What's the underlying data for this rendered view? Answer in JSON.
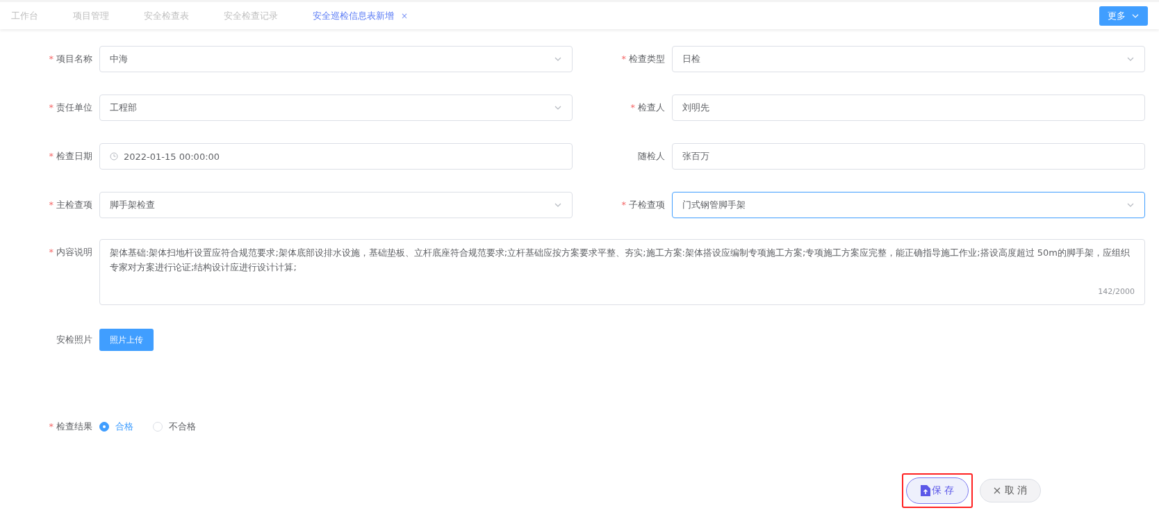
{
  "tabs": [
    {
      "label": "工作台",
      "selected": false
    },
    {
      "label": "项目管理",
      "selected": false
    },
    {
      "label": "安全检查表",
      "selected": false
    },
    {
      "label": "安全检查记录",
      "selected": false
    },
    {
      "label": "安全巡检信息表新增",
      "selected": true,
      "close": "×"
    }
  ],
  "more_button": {
    "label": "更多"
  },
  "fields": [
    {
      "label": "项目名称",
      "required_mark": "*",
      "kind": "select",
      "value": "中海",
      "focused": false
    },
    {
      "label": "检查类型",
      "required_mark": "*",
      "kind": "select",
      "value": "日检",
      "focused": false
    },
    {
      "label": "责任单位",
      "required_mark": "*",
      "kind": "select",
      "value": "工程部",
      "focused": false
    },
    {
      "label": "检查人",
      "required_mark": "*",
      "kind": "input",
      "value": "刘明先",
      "focused": false
    },
    {
      "label": "检查日期",
      "required_mark": "*",
      "kind": "date",
      "value": "2022-01-15 00:00:00",
      "focused": false
    },
    {
      "label": "随检人",
      "kind": "input",
      "value": "张百万",
      "focused": false
    },
    {
      "label": "主检查项",
      "required_mark": "*",
      "kind": "select",
      "value": "脚手架检查",
      "focused": false
    },
    {
      "label": "子检查项",
      "required_mark": "*",
      "kind": "select",
      "value": "门式钢管脚手架",
      "focused": true
    }
  ],
  "description": {
    "label": "内容说明",
    "required_mark": "*",
    "value": "架体基础:架体扫地杆设置应符合规范要求;架体底部设排水设施，基础垫板、立杆底座符合规范要求;立杆基础应按方案要求平整、夯实;施工方案:架体搭设应编制专项施工方案;专项施工方案应完整，能正确指导施工作业;搭设高度超过 50m的脚手架，应组织专家对方案进行论证;结构设计应进行设计计算;",
    "counter": "142/2000"
  },
  "photos": {
    "label": "安检照片",
    "button": "照片上传"
  },
  "result": {
    "label": "检查结果",
    "required_mark": "*",
    "options": [
      {
        "label": "合格",
        "selected": true
      },
      {
        "label": "不合格",
        "selected": false
      }
    ]
  },
  "save_button": {
    "label": "保 存",
    "highlighted": true
  },
  "cancel_button": {
    "label": "取 消"
  }
}
